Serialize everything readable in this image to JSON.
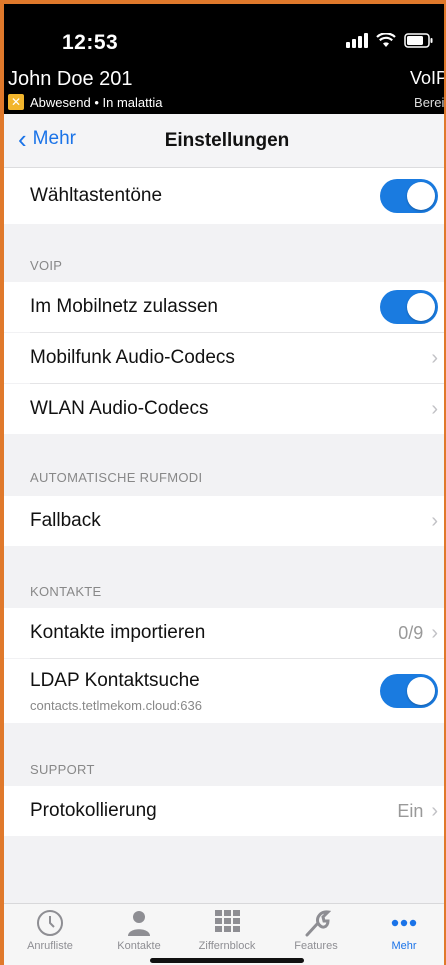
{
  "status_bar": {
    "time": "12:53"
  },
  "user": {
    "name": "John Doe 201",
    "status_text": "Abwesend • In malattia",
    "right_top": "VoIP",
    "right_bottom": "Bereit"
  },
  "nav": {
    "back_label": "Mehr",
    "title": "Einstellungen"
  },
  "rows": {
    "dialtones": {
      "label": "Wähltastentöne",
      "toggle_on": true
    },
    "mobile_allow": {
      "label": "Im Mobilnetz zulassen",
      "toggle_on": true
    },
    "mobile_codecs": {
      "label": "Mobilfunk Audio-Codecs"
    },
    "wlan_codecs": {
      "label": "WLAN Audio-Codecs"
    },
    "fallback": {
      "label": "Fallback"
    },
    "import_contacts": {
      "label": "Kontakte importieren",
      "value": "0/9"
    },
    "ldap": {
      "label": "LDAP Kontaktsuche",
      "sublabel": "contacts.tetlmekom.cloud:636",
      "toggle_on": true
    },
    "logging": {
      "label": "Protokollierung",
      "value": "Ein"
    }
  },
  "sections": {
    "voip": "VOIP",
    "auto_modes": "AUTOMATISCHE RUFMODI",
    "contacts": "KONTAKTE",
    "support": "SUPPORT"
  },
  "tabs": [
    {
      "label": "Anrufliste",
      "icon": "clock-icon"
    },
    {
      "label": "Kontakte",
      "icon": "person-icon"
    },
    {
      "label": "Ziffernblock",
      "icon": "keypad-icon"
    },
    {
      "label": "Features",
      "icon": "wrench-icon"
    },
    {
      "label": "Mehr",
      "icon": "more-dots-icon"
    }
  ],
  "colors": {
    "accent": "#1a73e8",
    "toggle": "#1a7be0",
    "frame": "#e0792b",
    "away": "#f2b52d"
  }
}
